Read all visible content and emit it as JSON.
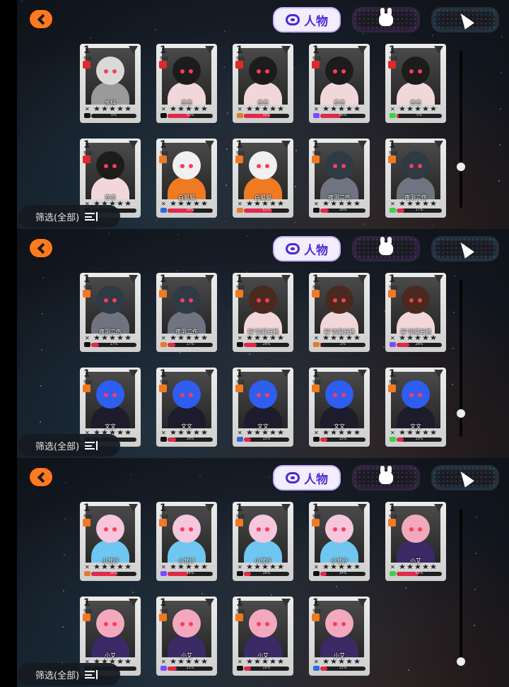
{
  "panels": [
    {
      "tabs": {
        "people_label": "人物"
      },
      "filter_label": "筛选(全部)",
      "scroll_fraction": 0.75,
      "cards": [
        {
          "level": "1",
          "name": "水科",
          "bar_text": "0%",
          "fill": 0.0,
          "hair": "#d9d9d9",
          "skin": "#9a9a9a",
          "badge": "#e02a2a",
          "rank_color": "#111111",
          "rank_label": "AB"
        },
        {
          "level": "1",
          "name": "幸幸",
          "bar_text": "50%",
          "fill": 0.5,
          "hair": "#1c1c1c",
          "skin": "#f1d7d9",
          "badge": "#e02a2a",
          "rank_color": "#111111",
          "rank_label": "AB"
        },
        {
          "level": "1",
          "name": "幸幸",
          "bar_text": "58%",
          "fill": 0.58,
          "hair": "#1c1c1c",
          "skin": "#f1d7d9",
          "badge": "#e02a2a",
          "rank_color": "#e57b2a",
          "rank_label": ""
        },
        {
          "level": "1",
          "name": "幸幸",
          "bar_text": "46%",
          "fill": 0.46,
          "hair": "#1c1c1c",
          "skin": "#f1d7d9",
          "badge": "#e02a2a",
          "rank_color": "#7b4bff",
          "rank_label": ""
        },
        {
          "level": "1",
          "name": "幸幸",
          "bar_text": "5%",
          "fill": 0.05,
          "hair": "#1c1c1c",
          "skin": "#f1d7d9",
          "badge": "#e02a2a",
          "rank_color": "#3cd14a",
          "rank_label": ""
        },
        {
          "level": "1",
          "name": "幸幸",
          "bar_text": "",
          "fill": 0.0,
          "hair": "#1c1c1c",
          "skin": "#f1d7d9",
          "badge": "#e02a2a",
          "rank_color": "#111111",
          "rank_label": ""
        },
        {
          "level": "1",
          "name": "白狐狐",
          "bar_text": "58%",
          "fill": 0.58,
          "hair": "#f0f0f0",
          "skin": "#f07a22",
          "badge": "#f07a22",
          "rank_color": "#2a6be0",
          "rank_label": "网"
        },
        {
          "level": "1",
          "name": "白狐狐",
          "bar_text": "62%",
          "fill": 0.62,
          "hair": "#f0f0f0",
          "skin": "#f07a22",
          "badge": "#f07a22",
          "rank_color": "#e57b2a",
          "rank_label": ""
        },
        {
          "level": "1",
          "name": "夜羽二伤",
          "bar_text": "18%",
          "fill": 0.18,
          "hair": "#2e3a44",
          "skin": "#6f7480",
          "badge": "#f07a22",
          "rank_color": "#111111",
          "rank_label": "网"
        },
        {
          "level": "1",
          "name": "夜羽二伤",
          "bar_text": "17%",
          "fill": 0.17,
          "hair": "#2e3a44",
          "skin": "#6f7480",
          "badge": "#f07a22",
          "rank_color": "#3cd14a",
          "rank_label": ""
        }
      ]
    },
    {
      "tabs": {
        "people_label": "人物"
      },
      "filter_label": "筛选(全部)",
      "scroll_fraction": 0.87,
      "cards": [
        {
          "level": "1",
          "name": "夜羽二伤",
          "bar_text": "17%",
          "fill": 0.17,
          "hair": "#2e3a44",
          "skin": "#6f7480",
          "badge": "#f07a22",
          "rank_color": "#111111",
          "rank_label": "AB"
        },
        {
          "level": "1",
          "name": "夜羽二伤",
          "bar_text": "17%",
          "fill": 0.17,
          "hair": "#2e3a44",
          "skin": "#6f7480",
          "badge": "#f07a22",
          "rank_color": "#e57b2a",
          "rank_label": ""
        },
        {
          "level": "1",
          "name": "褐°的暮云鸦",
          "bar_text": "28%",
          "fill": 0.28,
          "hair": "#4a2a1e",
          "skin": "#f1d7d9",
          "badge": "#f07a22",
          "rank_color": "#111111",
          "rank_label": "网"
        },
        {
          "level": "1",
          "name": "褐°的暮云鸦",
          "bar_text": "2%",
          "fill": 0.02,
          "hair": "#4a2a1e",
          "skin": "#f1d7d9",
          "badge": "#f07a22",
          "rank_color": "#e57b2a",
          "rank_label": ""
        },
        {
          "level": "1",
          "name": "褐°的暮云鸦",
          "bar_text": "28%",
          "fill": 0.28,
          "hair": "#4a2a1e",
          "skin": "#f1d7d9",
          "badge": "#f07a22",
          "rank_color": "#7b4bff",
          "rank_label": ""
        },
        {
          "level": "1",
          "name": "文文",
          "bar_text": "",
          "fill": 0.0,
          "hair": "#2d5ef0",
          "skin": "#1c1c2c",
          "badge": "#f07a22",
          "rank_color": "#111111",
          "rank_label": ""
        },
        {
          "level": "1",
          "name": "文文",
          "bar_text": "18%",
          "fill": 0.18,
          "hair": "#2d5ef0",
          "skin": "#1c1c2c",
          "badge": "#f07a22",
          "rank_color": "#111111",
          "rank_label": "AB"
        },
        {
          "level": "1",
          "name": "文文",
          "bar_text": "15%",
          "fill": 0.15,
          "hair": "#2d5ef0",
          "skin": "#1c1c2c",
          "badge": "#f07a22",
          "rank_color": "#2a6be0",
          "rank_label": ""
        },
        {
          "level": "1",
          "name": "文文",
          "bar_text": "15%",
          "fill": 0.15,
          "hair": "#2d5ef0",
          "skin": "#1c1c2c",
          "badge": "#f07a22",
          "rank_color": "#111111",
          "rank_label": "网"
        },
        {
          "level": "1",
          "name": "文文",
          "bar_text": "15%",
          "fill": 0.15,
          "hair": "#2d5ef0",
          "skin": "#1c1c2c",
          "badge": "#f07a22",
          "rank_color": "#3cd14a",
          "rank_label": ""
        }
      ]
    },
    {
      "tabs": {
        "people_label": "人物"
      },
      "filter_label": "筛选(全部)",
      "scroll_fraction": 1.0,
      "cards": [
        {
          "level": "1",
          "name": "小甘汐",
          "bar_text": "58%",
          "fill": 0.58,
          "hair": "#f5c6dc",
          "skin": "#6fc6f0",
          "badge": "#f07a22",
          "rank_color": "#e57b2a",
          "rank_label": ""
        },
        {
          "level": "1",
          "name": "小甘汐",
          "bar_text": "46%",
          "fill": 0.46,
          "hair": "#f5c6dc",
          "skin": "#6fc6f0",
          "badge": "#f07a22",
          "rank_color": "#7b4bff",
          "rank_label": ""
        },
        {
          "level": "1",
          "name": "小甘汐",
          "bar_text": "16%",
          "fill": 0.16,
          "hair": "#f5c6dc",
          "skin": "#6fc6f0",
          "badge": "#f07a22",
          "rank_color": "#111111",
          "rank_label": ""
        },
        {
          "level": "1",
          "name": "小甘汐",
          "bar_text": "14%",
          "fill": 0.14,
          "hair": "#f5c6dc",
          "skin": "#6fc6f0",
          "badge": "#f07a22",
          "rank_color": "#111111",
          "rank_label": ""
        },
        {
          "level": "1",
          "name": "小艾",
          "bar_text": "48%",
          "fill": 0.48,
          "hair": "#f2a9bd",
          "skin": "#3a2a66",
          "badge": "#f07a22",
          "rank_color": "#3cd14a",
          "rank_label": ""
        },
        {
          "level": "1",
          "name": "小艾",
          "bar_text": "",
          "fill": 0.0,
          "hair": "#f2a9bd",
          "skin": "#3a2a66",
          "badge": "#f07a22",
          "rank_color": "#111111",
          "rank_label": ""
        },
        {
          "level": "1",
          "name": "小艾",
          "bar_text": "21%",
          "fill": 0.21,
          "hair": "#f2a9bd",
          "skin": "#3a2a66",
          "badge": "#f07a22",
          "rank_color": "#7b4bff",
          "rank_label": ""
        },
        {
          "level": "1",
          "name": "小艾",
          "bar_text": "15%",
          "fill": 0.15,
          "hair": "#f2a9bd",
          "skin": "#3a2a66",
          "badge": "#f07a22",
          "rank_color": "#111111",
          "rank_label": "网"
        },
        {
          "level": "1",
          "name": "小艾",
          "bar_text": "15%",
          "fill": 0.15,
          "hair": "#f2a9bd",
          "skin": "#3a2a66",
          "badge": "#f07a22",
          "rank_color": "#2a6be0",
          "rank_label": ""
        }
      ]
    }
  ],
  "colors": {
    "accent": "#ff7a1f",
    "tab_active_text": "#4b2ad6",
    "bar_fill": "#e02a4a"
  }
}
